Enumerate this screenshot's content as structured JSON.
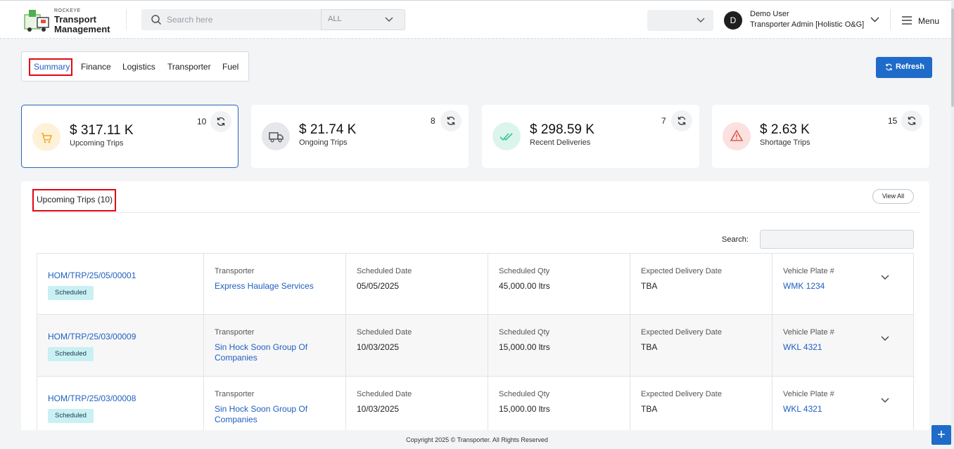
{
  "header": {
    "brand_small": "ROCKEYE",
    "brand_line1": "Transport",
    "brand_line2": "Management",
    "search_placeholder": "Search here",
    "category_value": "ALL",
    "user_initial": "D",
    "user_name": "Demo User",
    "user_role": "Transporter Admin [Holistic O&G]",
    "menu_label": "Menu"
  },
  "tabs": [
    {
      "label": "Summary",
      "active": true
    },
    {
      "label": "Finance",
      "active": false
    },
    {
      "label": "Logistics",
      "active": false
    },
    {
      "label": "Transporter",
      "active": false
    },
    {
      "label": "Fuel",
      "active": false
    }
  ],
  "refresh_label": "Refresh",
  "cards": [
    {
      "amount": "$ 317.11 K",
      "label": "Upcoming Trips",
      "count": "10",
      "icon": "cart-icon",
      "color": "#f5a623"
    },
    {
      "amount": "$ 21.74 K",
      "label": "Ongoing Trips",
      "count": "8",
      "icon": "truck-icon",
      "color": "#6b7280"
    },
    {
      "amount": "$ 298.59 K",
      "label": "Recent Deliveries",
      "count": "7",
      "icon": "double-check-icon",
      "color": "#34c39a"
    },
    {
      "amount": "$ 2.63 K",
      "label": "Shortage Trips",
      "count": "15",
      "icon": "warning-icon",
      "color": "#e05a4f"
    }
  ],
  "trips": {
    "title": "Upcoming Trips (10)",
    "view_all": "View All",
    "search_label": "Search:",
    "col_transporter": "Transporter",
    "col_sched_date": "Scheduled Date",
    "col_sched_qty": "Scheduled Qty",
    "col_exp_date": "Expected Delivery Date",
    "col_plate": "Vehicle Plate #",
    "rows": [
      {
        "id": "HOM/TRP/25/05/00001",
        "status": "Scheduled",
        "transporter_l1": "Express Haulage Services",
        "transporter_l2": "",
        "date": "05/05/2025",
        "qty": "45,000.00 ltrs",
        "expected": "TBA",
        "plate": "WMK 1234"
      },
      {
        "id": "HOM/TRP/25/03/00009",
        "status": "Scheduled",
        "transporter_l1": "Sin Hock Soon Group Of",
        "transporter_l2": "Companies",
        "date": "10/03/2025",
        "qty": "15,000.00 ltrs",
        "expected": "TBA",
        "plate": "WKL 4321"
      },
      {
        "id": "HOM/TRP/25/03/00008",
        "status": "Scheduled",
        "transporter_l1": "Sin Hock Soon Group Of",
        "transporter_l2": "Companies",
        "date": "10/03/2025",
        "qty": "15,000.00 ltrs",
        "expected": "TBA",
        "plate": "WKL 4321"
      }
    ]
  },
  "footer": "Copyright 2025 © Transporter. All Rights Reserved",
  "fab_label": "+"
}
